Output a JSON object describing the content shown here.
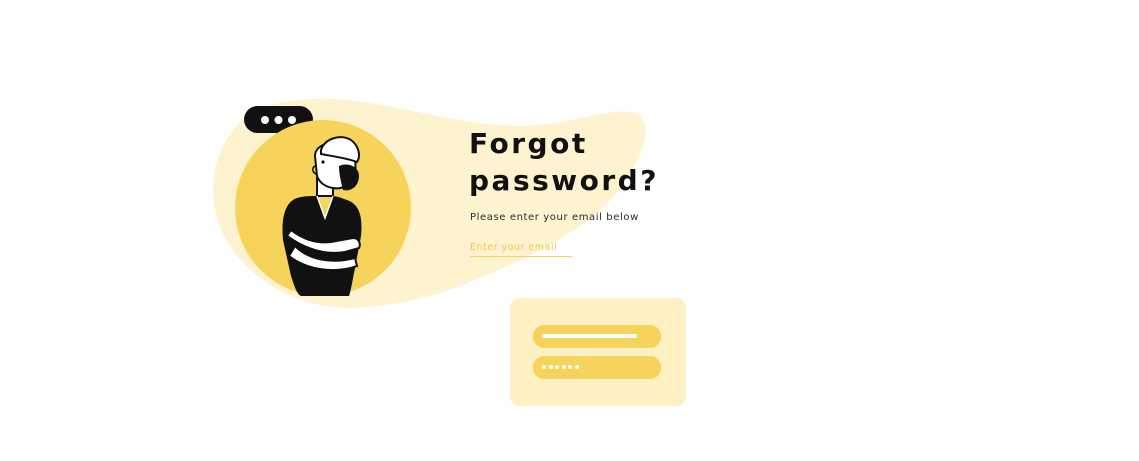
{
  "heading": {
    "line1": "Forgot",
    "line2": "password?"
  },
  "subtitle": "Please enter your email below",
  "email_input": {
    "placeholder": "Enter your email",
    "value": ""
  },
  "illustration": {
    "chat_bubble_icon": "speech-bubble-ellipsis-icon",
    "character": "person-arms-crossed-thinking"
  },
  "login_card": {
    "password_dots": 6
  },
  "colors": {
    "background": "#ffffff",
    "accent_yellow": "#f6d35a",
    "light_yellow": "#fdf0c2",
    "text_dark": "#111111"
  }
}
